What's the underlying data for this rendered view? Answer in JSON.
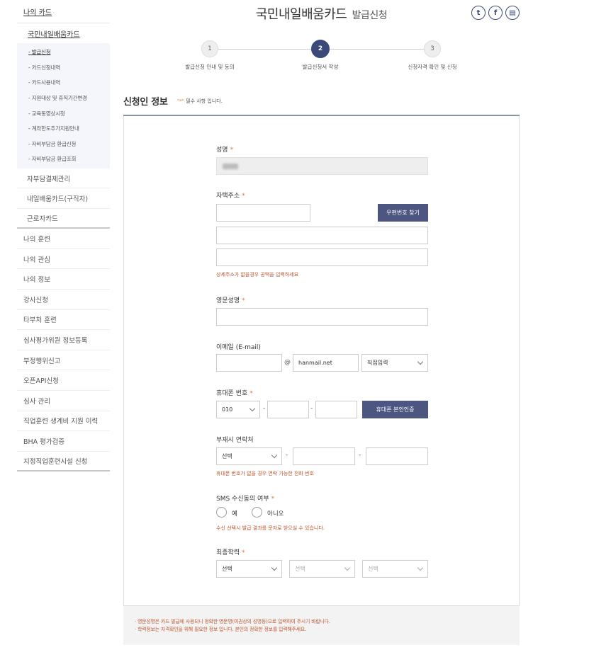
{
  "sidebar": {
    "top": "나의 카드",
    "sub": "국민내일배움카드",
    "subsub": [
      "- 발급신청",
      "- 카드신청내역",
      "- 카드사용내역",
      "- 지원대상 및 휴직기간변경",
      "- 교육동영상시청",
      "- 계좌한도추가지원안내",
      "- 자비부담금 환급신청",
      "- 자비부담금 환급조회"
    ],
    "level2": [
      "자부담결제관리",
      "내일배움카드(구직자)",
      "근로자카드"
    ],
    "items": [
      "나의 훈련",
      "나의 관심",
      "나의 정보",
      "강사신청",
      "타부처 훈련",
      "심사평가위원 정보등록",
      "부정행위신고",
      "오픈API신청",
      "심사 관리",
      "직업훈련 생계비 지원 이력",
      "BHA 평가검증",
      "지정직업훈련시설 신청"
    ]
  },
  "header": {
    "title": "국민내일배움카드",
    "subtitle": "발급신청",
    "share_icons": [
      "twitter-icon",
      "facebook-icon",
      "print-icon"
    ]
  },
  "steps": [
    {
      "num": "1",
      "label": "발급신청 안내 및 동의"
    },
    {
      "num": "2",
      "label": "발급신청서 작성"
    },
    {
      "num": "3",
      "label": "신청자격 확인 및 신청"
    }
  ],
  "section": {
    "title": "신청인 정보",
    "req_star": "\"*\"",
    "req_text": " 필수 사항 입니다."
  },
  "form": {
    "star": "*",
    "name_label": "성명",
    "address_label": "자택주소",
    "zip_button": "우편번호 찾기",
    "address_hint": "상세주소가 없을경우 공백을 입력하세요",
    "eng_name_label": "영문성명",
    "email_label": "이메일 (E-mail)",
    "email_at": "@",
    "email_domain": "hanmail.net",
    "email_select": "직접입력",
    "phone_label": "휴대폰 번호",
    "phone_prefix": "010",
    "dash": "-",
    "phone_button": "휴대폰 본인인증",
    "alt_phone_label": "부재시 연락처",
    "alt_phone_select": "선택",
    "alt_phone_hint": "휴대폰 번호가 없을 경우 연락 가능한 전화 번호",
    "sms_label": "SMS 수신동의 여부",
    "sms_yes": "예",
    "sms_no": "아니오",
    "sms_hint": "수신 선택시 발급 결과를 문자로 받으실 수 있습니다.",
    "edu_label": "최종학력",
    "edu_select1": "선택",
    "edu_select2": "선택",
    "edu_select3": "선택"
  },
  "notes": [
    "· 영문성명은 카드 발급에 사용되니 정확한 영문명(여권상의 성명등)으로 입력하여 주시기 바랍니다.",
    "· 학력정보는 자격확인을 위해 필요한 정보 입니다. 본인의 정확한 정보를 입력해주세요."
  ]
}
